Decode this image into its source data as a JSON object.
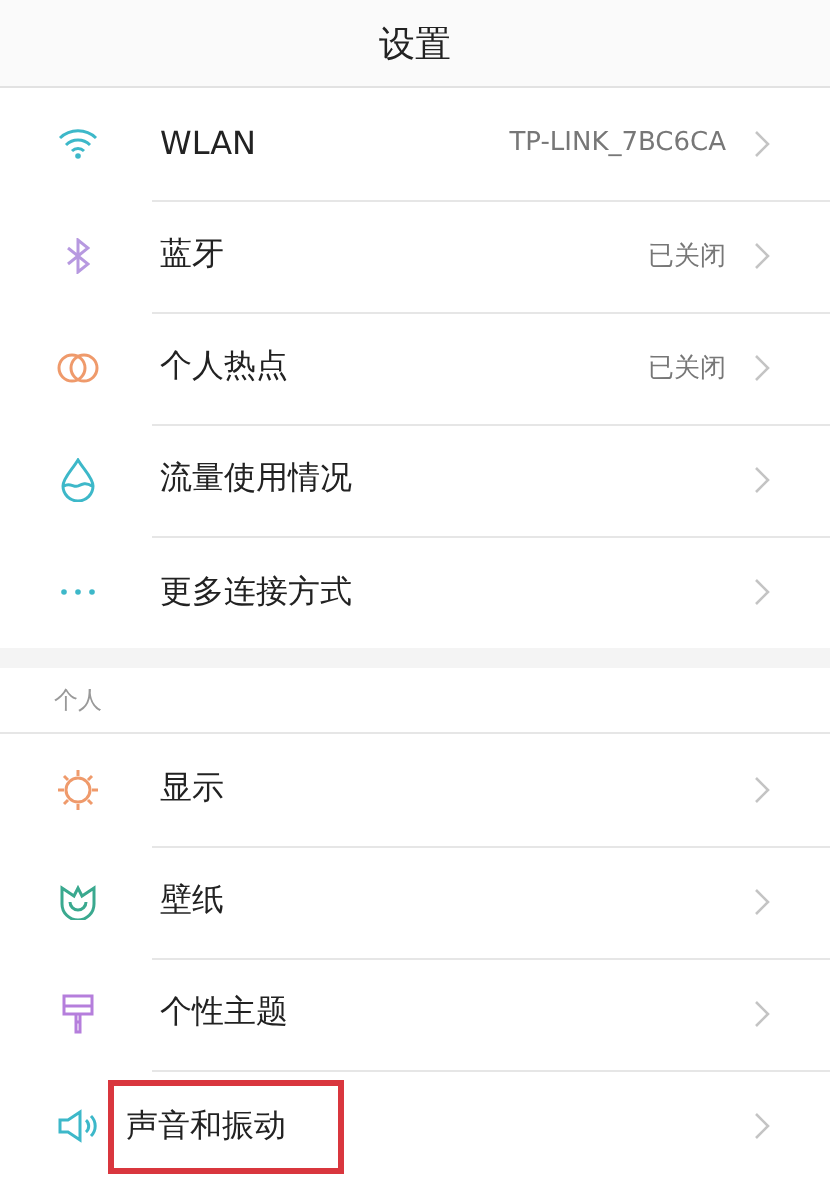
{
  "header": {
    "title": "设置"
  },
  "sections": [
    {
      "rows": [
        {
          "label": "WLAN",
          "value": "TP-LINK_7BC6CA",
          "highlighted": false
        },
        {
          "label": "蓝牙",
          "value": "已关闭",
          "highlighted": false
        },
        {
          "label": "个人热点",
          "value": "已关闭",
          "highlighted": false
        },
        {
          "label": "流量使用情况",
          "highlighted": false
        },
        {
          "label": "更多连接方式",
          "highlighted": false
        }
      ]
    },
    {
      "heading": "个人",
      "rows": [
        {
          "label": "显示",
          "highlighted": false
        },
        {
          "label": "壁纸",
          "highlighted": false
        },
        {
          "label": "个性主题",
          "highlighted": false
        },
        {
          "label": "声音和振动",
          "highlighted": true
        }
      ]
    }
  ]
}
